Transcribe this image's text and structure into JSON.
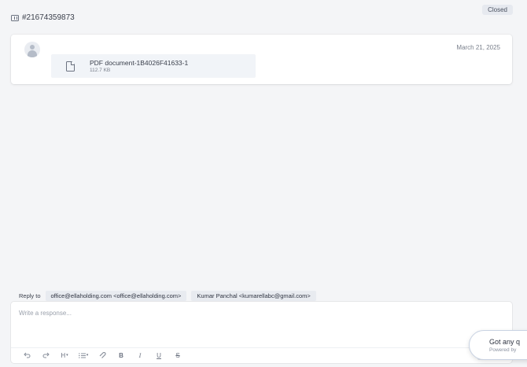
{
  "ticket": {
    "id": "#21674359873",
    "status": "Closed"
  },
  "message": {
    "date": "March 21, 2025",
    "avatar_icon": "user-avatar-icon",
    "attachment": {
      "icon": "file-icon",
      "name": "PDF document-1B4026F41633-1",
      "size": "112.7 KB"
    }
  },
  "reply": {
    "label": "Reply to",
    "recipients": [
      "office@ellaholding.com <office@ellaholding.com>",
      "Kumar Panchal <kumarellabc@gmail.com>"
    ]
  },
  "composer": {
    "placeholder": "Write a response...",
    "toolbar": {
      "undo": "undo-icon",
      "redo": "redo-icon",
      "heading": "H",
      "list": "list-icon",
      "attach": "attach-icon",
      "bold": "B",
      "italic": "I",
      "underline": "U",
      "strike": "S"
    }
  },
  "chat_widget": {
    "title": "Got any q",
    "powered": "Powered by"
  },
  "colors": {
    "background": "#f4f5f7",
    "card": "#ffffff",
    "chip": "#e8ebf0",
    "badge": "#e6e9ef"
  }
}
